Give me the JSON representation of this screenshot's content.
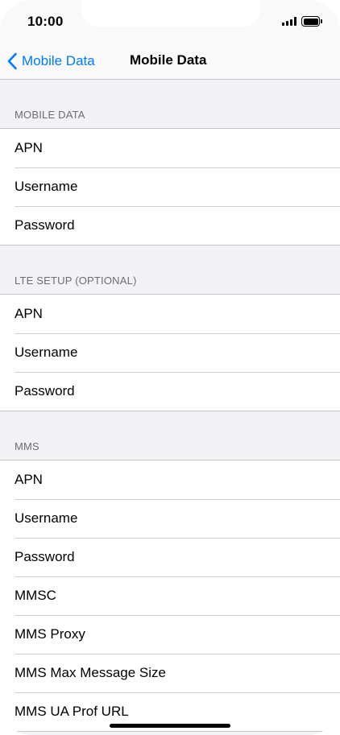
{
  "status_bar": {
    "time": "10:00",
    "signal_icon": "cellular-signal-icon",
    "battery_icon": "battery-icon"
  },
  "nav": {
    "back_label": "Mobile Data",
    "back_icon": "chevron-left-icon",
    "title": "Mobile Data",
    "accent_color": "#007aff"
  },
  "sections": [
    {
      "header": "MOBILE DATA",
      "rows": [
        "APN",
        "Username",
        "Password"
      ]
    },
    {
      "header": "LTE SETUP (OPTIONAL)",
      "rows": [
        "APN",
        "Username",
        "Password"
      ]
    },
    {
      "header": "MMS",
      "rows": [
        "APN",
        "Username",
        "Password",
        "MMSC",
        "MMS Proxy",
        "MMS Max Message Size",
        "MMS UA Prof URL"
      ]
    }
  ]
}
